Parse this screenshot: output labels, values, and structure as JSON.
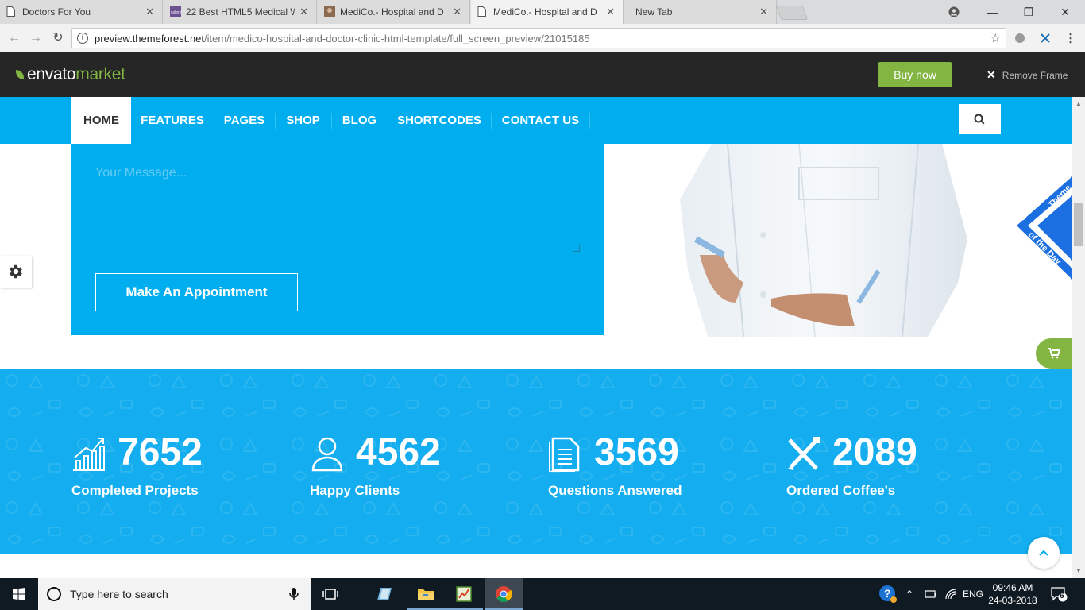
{
  "browser": {
    "tabs": [
      {
        "label": "Doctors For You"
      },
      {
        "label": "22 Best HTML5 Medical W"
      },
      {
        "label": "MediCo.- Hospital and D"
      },
      {
        "label": "MediCo.- Hospital and D"
      },
      {
        "label": "New Tab"
      }
    ],
    "url_host": "preview.themeforest.net",
    "url_path": "/item/medico-hospital-and-doctor-clinic-html-template/full_screen_preview/21015185"
  },
  "envato": {
    "logo_envato": "envato",
    "logo_market": "market",
    "buy_label": "Buy now",
    "remove_label": "Remove Frame"
  },
  "nav": {
    "items": [
      {
        "label": "HOME"
      },
      {
        "label": "FEATURES"
      },
      {
        "label": "PAGES"
      },
      {
        "label": "SHOP"
      },
      {
        "label": "BLOG"
      },
      {
        "label": "SHORTCODES"
      },
      {
        "label": "CONTACT US"
      }
    ]
  },
  "form": {
    "message_placeholder": "Your Message...",
    "appointment_label": "Make An Appointment"
  },
  "badge": {
    "line1": "Theme",
    "line2": "of the Day",
    "logo": "DV"
  },
  "stats": [
    {
      "number": "7652",
      "label": "Completed Projects",
      "icon": "chart-icon"
    },
    {
      "number": "4562",
      "label": "Happy Clients",
      "icon": "user-icon"
    },
    {
      "number": "3569",
      "label": "Questions Answered",
      "icon": "document-icon"
    },
    {
      "number": "2089",
      "label": "Ordered Coffee's",
      "icon": "tools-icon"
    }
  ],
  "taskbar": {
    "search_placeholder": "Type here to search",
    "language": "ENG",
    "time": "09:46 AM",
    "date": "24-03-2018",
    "notifications": "6"
  },
  "colors": {
    "primary": "#00aef0",
    "stats_bg": "#14adef",
    "accent": "#82b541",
    "envato_bar": "#262626"
  }
}
